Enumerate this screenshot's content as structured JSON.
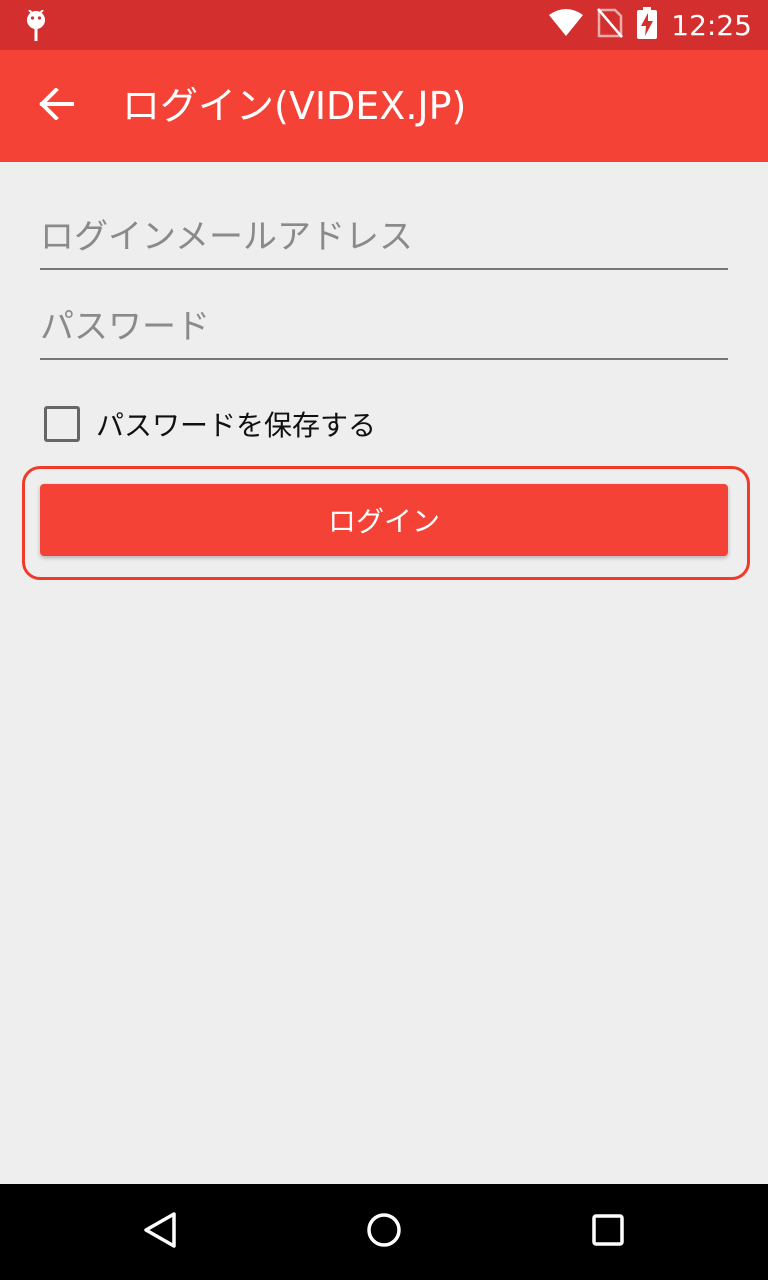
{
  "status_bar": {
    "time": "12:25",
    "icons": [
      "android-debug-icon",
      "wifi-icon",
      "no-sim-icon",
      "battery-charging-icon"
    ]
  },
  "app_bar": {
    "title": "ログイン(VIDEX.JP)",
    "back_icon": "arrow-back-icon"
  },
  "form": {
    "email_placeholder": "ログインメールアドレス",
    "email_value": "",
    "password_placeholder": "パスワード",
    "password_value": "",
    "remember_label": "パスワードを保存する",
    "remember_checked": false,
    "login_label": "ログイン"
  },
  "nav_bar": {
    "icons": [
      "back-triangle-icon",
      "home-circle-icon",
      "recent-square-icon"
    ]
  },
  "colors": {
    "status_bar": "#D32F2F",
    "app_bar": "#F44336",
    "background": "#EEEEEE",
    "highlight": "#F03A2A"
  }
}
